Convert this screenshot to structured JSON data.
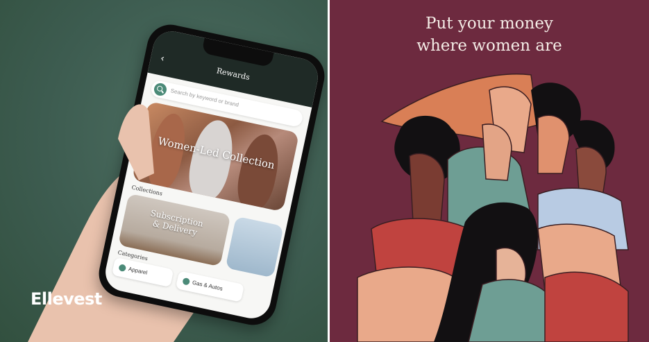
{
  "brand": {
    "logo_text": "Ellevest"
  },
  "phone_app": {
    "header_title": "Rewards",
    "back_glyph": "‹",
    "search": {
      "placeholder": "Search by keyword or brand",
      "icon": "search-icon"
    },
    "featured_card": {
      "title": "Women-Led Collection"
    },
    "collections_label": "Collections",
    "collection_cards": [
      {
        "title_line1": "Subscription",
        "title_line2": "& Delivery"
      }
    ],
    "categories_label": "Categories",
    "categories": [
      {
        "label": "Apparel",
        "icon": "apparel-icon"
      },
      {
        "label": "Gas & Autos",
        "icon": "car-icon"
      }
    ]
  },
  "right_panel": {
    "headline_line1": "Put your money",
    "headline_line2": "where women are"
  },
  "colors": {
    "left_bg": "#3d5c50",
    "right_bg": "#6d2a3f",
    "app_accent": "#4b8a78",
    "headline_text": "#f4ece6"
  }
}
